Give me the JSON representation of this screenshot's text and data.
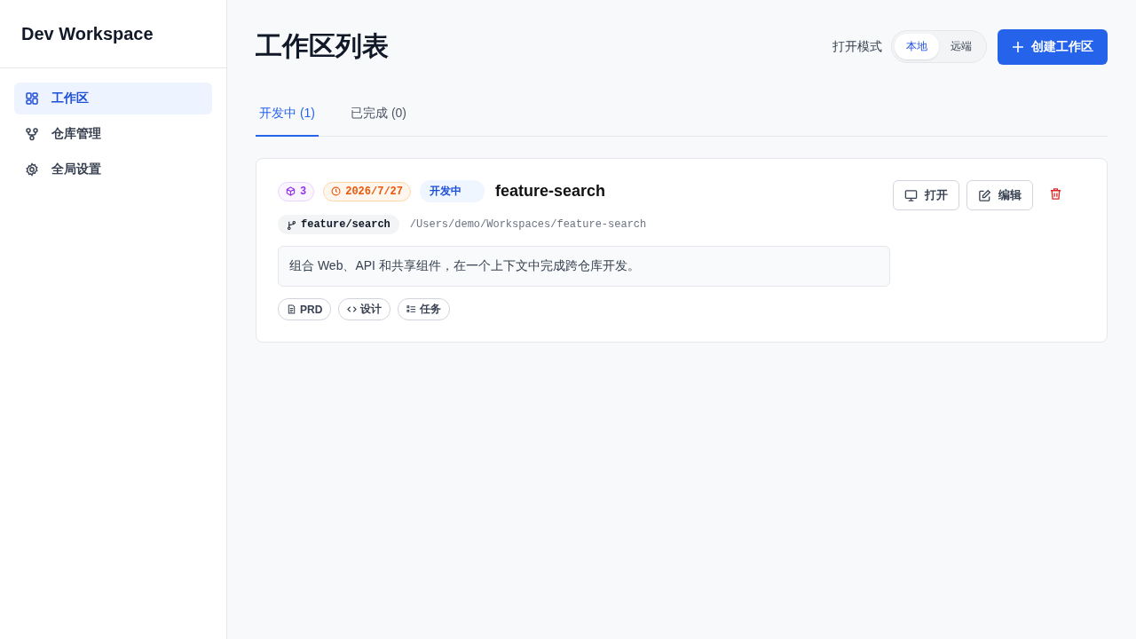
{
  "sidebar": {
    "title": "Dev Workspace",
    "items": [
      {
        "label": "工作区",
        "kind": "grid",
        "selected": true
      },
      {
        "label": "仓库管理",
        "kind": "repo",
        "selected": false
      },
      {
        "label": "全局设置",
        "kind": "gear",
        "selected": false
      }
    ]
  },
  "header": {
    "title": "工作区列表",
    "mode_label": "打开模式",
    "modes": [
      {
        "label": "本地",
        "selected": true
      },
      {
        "label": "远端",
        "selected": false
      }
    ],
    "create_button": "创建工作区"
  },
  "tabs": [
    {
      "label": "开发中 (1)",
      "selected": true
    },
    {
      "label": "已完成 (0)",
      "selected": false
    }
  ],
  "workspaces": [
    {
      "repo_count": "3",
      "date": "2026/7/27",
      "status": "开发中",
      "name": "feature-search",
      "branch": "feature/search",
      "path": "/Users/demo/Workspaces/feature-search",
      "description": "组合 Web、API 和共享组件，在一个上下文中完成跨仓库开发。",
      "docs": [
        {
          "label": "PRD",
          "kind": "file"
        },
        {
          "label": "设计",
          "kind": "code"
        },
        {
          "label": "任务",
          "kind": "list"
        }
      ],
      "actions": [
        "打开",
        "编辑"
      ]
    }
  ]
}
